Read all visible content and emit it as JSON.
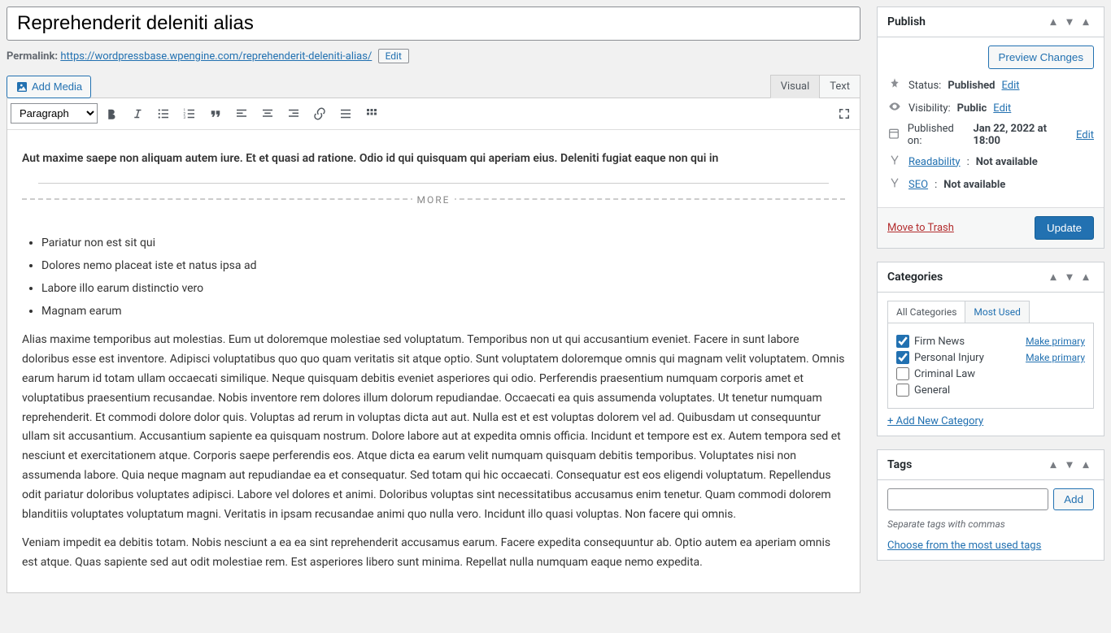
{
  "title": "Reprehenderit deleniti alias",
  "permalink": {
    "label": "Permalink:",
    "url": "https://wordpressbase.wpengine.com/reprehenderit-deleniti-alias/",
    "edit": "Edit"
  },
  "add_media": "Add Media",
  "tabs": {
    "visual": "Visual",
    "text": "Text"
  },
  "format_select": "Paragraph",
  "content": {
    "lead": "Aut maxime saepe non aliquam autem iure. Et et quasi ad ratione. Odio id qui quisquam qui aperiam eius. Deleniti fugiat eaque non qui in",
    "more": "MORE",
    "bullets": [
      "Pariatur non est sit qui",
      "Dolores nemo placeat iste et natus ipsa ad",
      "Labore illo earum distinctio vero",
      "Magnam earum"
    ],
    "para1": "Alias maxime temporibus aut molestias. Eum ut doloremque molestiae sed voluptatum. Temporibus non ut qui accusantium eveniet. Facere in sunt labore doloribus esse est inventore. Adipisci voluptatibus quo quo quam veritatis sit atque optio. Sunt voluptatem doloremque omnis qui magnam velit voluptatem. Omnis earum harum id totam ullam occaecati similique. Neque quisquam debitis eveniet asperiores qui odio. Perferendis praesentium numquam corporis amet et voluptatibus praesentium recusandae. Nobis inventore rem dolores illum dolorum repudiandae. Occaecati ea quis assumenda voluptates. Ut tenetur numquam reprehenderit. Et commodi dolore dolor quis. Voluptas ad rerum in voluptas dicta aut aut. Nulla est et est voluptas dolorem vel ad. Quibusdam ut consequuntur ullam sit accusantium. Accusantium sapiente ea quisquam nostrum. Dolore labore aut at expedita omnis officia. Incidunt et tempore est ex. Autem tempora sed et nesciunt et exercitationem atque. Corporis saepe perferendis eos. Atque dicta ea earum velit numquam quisquam debitis temporibus. Voluptates nisi non assumenda labore. Quia neque magnam aut repudiandae ea et consequatur. Sed totam qui hic occaecati. Consequatur est eos eligendi voluptatum. Repellendus odit pariatur doloribus voluptates adipisci. Labore vel dolores et animi. Doloribus voluptas sint necessitatibus accusamus enim tenetur. Quam commodi dolorem blanditiis voluptates voluptatum magni. Veritatis in ipsam recusandae animi quo nulla vero. Incidunt illo quasi voluptas. Non facere qui omnis.",
    "para2": "Veniam impedit ea debitis totam. Nobis nesciunt a ea ea sint reprehenderit accusamus earum. Facere expedita consequuntur ab. Optio autem ea aperiam omnis est atque. Quas sapiente sed aut odit molestiae rem. Est asperiores libero sunt minima. Repellat nulla numquam eaque nemo expedita."
  },
  "publish": {
    "title": "Publish",
    "preview": "Preview Changes",
    "status_label": "Status:",
    "status_value": "Published",
    "status_edit": "Edit",
    "visibility_label": "Visibility:",
    "visibility_value": "Public",
    "visibility_edit": "Edit",
    "published_label": "Published on:",
    "published_value": "Jan 22, 2022 at 18:00",
    "published_edit": "Edit",
    "readability_label": "Readability",
    "readability_value": "Not available",
    "seo_label": "SEO",
    "seo_value": "Not available",
    "trash": "Move to Trash",
    "update": "Update"
  },
  "categories": {
    "title": "Categories",
    "tab_all": "All Categories",
    "tab_most": "Most Used",
    "items": [
      {
        "label": "Firm News",
        "checked": true,
        "primary": true
      },
      {
        "label": "Personal Injury",
        "checked": true,
        "primary": true
      },
      {
        "label": "Criminal Law",
        "checked": false,
        "primary": false
      },
      {
        "label": "General",
        "checked": false,
        "primary": false
      }
    ],
    "make_primary": "Make primary",
    "add_new": "+ Add New Category"
  },
  "tags": {
    "title": "Tags",
    "add": "Add",
    "hint": "Separate tags with commas",
    "choose": "Choose from the most used tags"
  }
}
